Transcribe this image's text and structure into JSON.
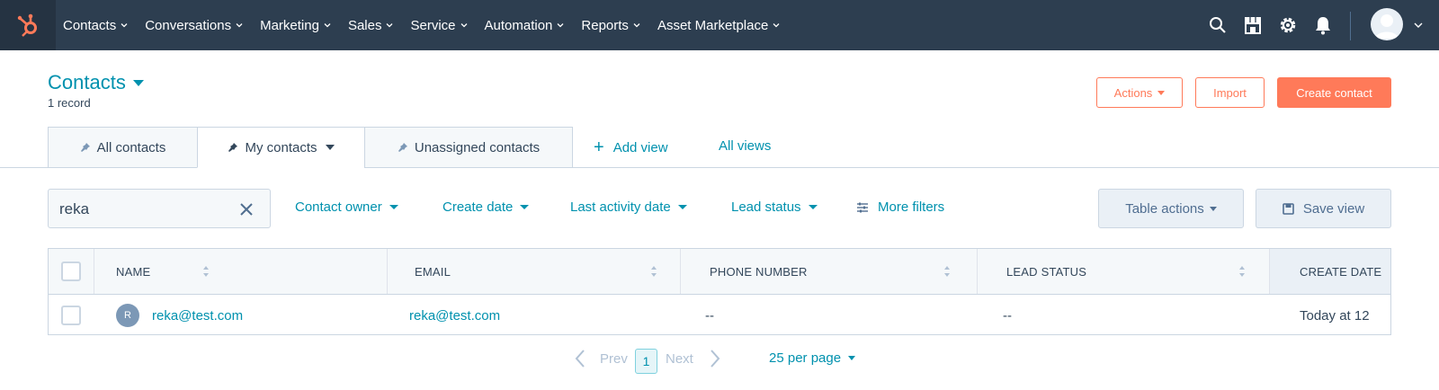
{
  "nav": {
    "items": [
      {
        "label": "Contacts"
      },
      {
        "label": "Conversations"
      },
      {
        "label": "Marketing"
      },
      {
        "label": "Sales"
      },
      {
        "label": "Service"
      },
      {
        "label": "Automation"
      },
      {
        "label": "Reports"
      },
      {
        "label": "Asset Marketplace"
      }
    ],
    "icons": [
      "search-icon",
      "marketplace-icon",
      "gear-icon",
      "bell-icon"
    ]
  },
  "header": {
    "title": "Contacts",
    "record_count": "1 record",
    "actions_label": "Actions",
    "import_label": "Import",
    "create_label": "Create contact"
  },
  "tabs": [
    {
      "label": "All contacts",
      "active": false
    },
    {
      "label": "My contacts",
      "active": true
    },
    {
      "label": "Unassigned contacts",
      "active": false
    }
  ],
  "views": {
    "add_label": "Add view",
    "all_label": "All views"
  },
  "filters": {
    "search_value": "reka",
    "contact_owner": "Contact owner",
    "create_date": "Create date",
    "last_activity": "Last activity date",
    "lead_status": "Lead status",
    "more_filters": "More filters",
    "table_actions": "Table actions",
    "save_view": "Save view"
  },
  "table": {
    "columns": [
      "NAME",
      "EMAIL",
      "PHONE NUMBER",
      "LEAD STATUS",
      "CREATE DATE"
    ],
    "rows": [
      {
        "initial": "R",
        "name": "reka@test.com",
        "email": "reka@test.com",
        "phone": "--",
        "lead_status": "--",
        "create_date": "Today at 12"
      }
    ]
  },
  "pagination": {
    "prev": "Prev",
    "page": "1",
    "next": "Next",
    "per_page": "25 per page"
  },
  "colors": {
    "nav_bg": "#2d3e50",
    "accent": "#ff7a59",
    "link": "#0091ae"
  }
}
